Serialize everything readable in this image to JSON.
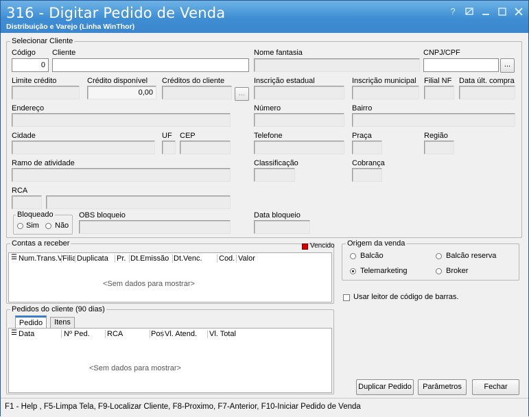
{
  "window": {
    "title": "316 - Digitar Pedido de Venda",
    "subtitle": "Distribuição e Varejo (Linha WinThor)",
    "controls": [
      "help-icon",
      "restore-icon",
      "minimize-icon",
      "maximize-icon",
      "close-icon"
    ]
  },
  "cliente": {
    "legend": "Selecionar Cliente",
    "codigo_label": "Código",
    "codigo_value": "0",
    "cliente_label": "Cliente",
    "nome_fantasia_label": "Nome fantasia",
    "cnpj_label": "CNPJ/CPF",
    "cnpj_button": "...",
    "limite_label": "Limite crédito",
    "credito_disp_label": "Crédito disponível",
    "credito_disp_value": "0,00",
    "creditos_cliente_label": "Créditos do cliente",
    "creditos_button": "...",
    "inscricao_estadual_label": "Inscrição estadual",
    "inscricao_municipal_label": "Inscrição municipal",
    "filial_nf_label": "Filial NF",
    "data_ult_compra_label": "Data últ. compra",
    "endereco_label": "Endereço",
    "numero_label": "Número",
    "bairro_label": "Bairro",
    "cidade_label": "Cidade",
    "uf_label": "UF",
    "cep_label": "CEP",
    "telefone_label": "Telefone",
    "praca_label": "Praça",
    "regiao_label": "Região",
    "ramo_label": "Ramo de atividade",
    "classificacao_label": "Classificação",
    "cobranca_label": "Cobrança",
    "rca_label": "RCA",
    "bloqueado_legend": "Bloqueado",
    "sim_label": "Sim",
    "nao_label": "Não",
    "obs_bloqueio_label": "OBS bloqueio",
    "data_bloqueio_label": "Data bloqueio"
  },
  "contas": {
    "legend": "Contas a receber",
    "vencido_label": "Vencido",
    "vencido_color": "#d40000",
    "columns": [
      "Num.Trans.V",
      "Filia",
      "Duplicata",
      "Pr.",
      "Dt.Emissão",
      "Dt.Venc.",
      "Cod.",
      "Valor"
    ],
    "empty": "<Sem dados para mostrar>"
  },
  "origem": {
    "legend": "Origem da venda",
    "options": [
      "Balcão",
      "Balcão reserva",
      "Telemarketing",
      "Broker"
    ],
    "selected": "Telemarketing"
  },
  "barcode_label": "Usar leitor de código de barras.",
  "pedidos": {
    "legend": "Pedidos do cliente (90 dias)",
    "tabs": [
      "Pedido",
      "Itens"
    ],
    "columns": [
      "Data",
      "Nº Ped.",
      "RCA",
      "Pos",
      "Vl. Atend.",
      "Vl. Total"
    ],
    "empty": "<Sem dados para mostrar>"
  },
  "buttons": {
    "duplicar": "Duplicar Pedido",
    "parametros": "Parâmetros",
    "fechar": "Fechar"
  },
  "status": "F1 - Help , F5-Limpa Tela, F9-Localizar Cliente, F8-Proximo, F7-Anterior, F10-Iniciar Pedido de Venda"
}
